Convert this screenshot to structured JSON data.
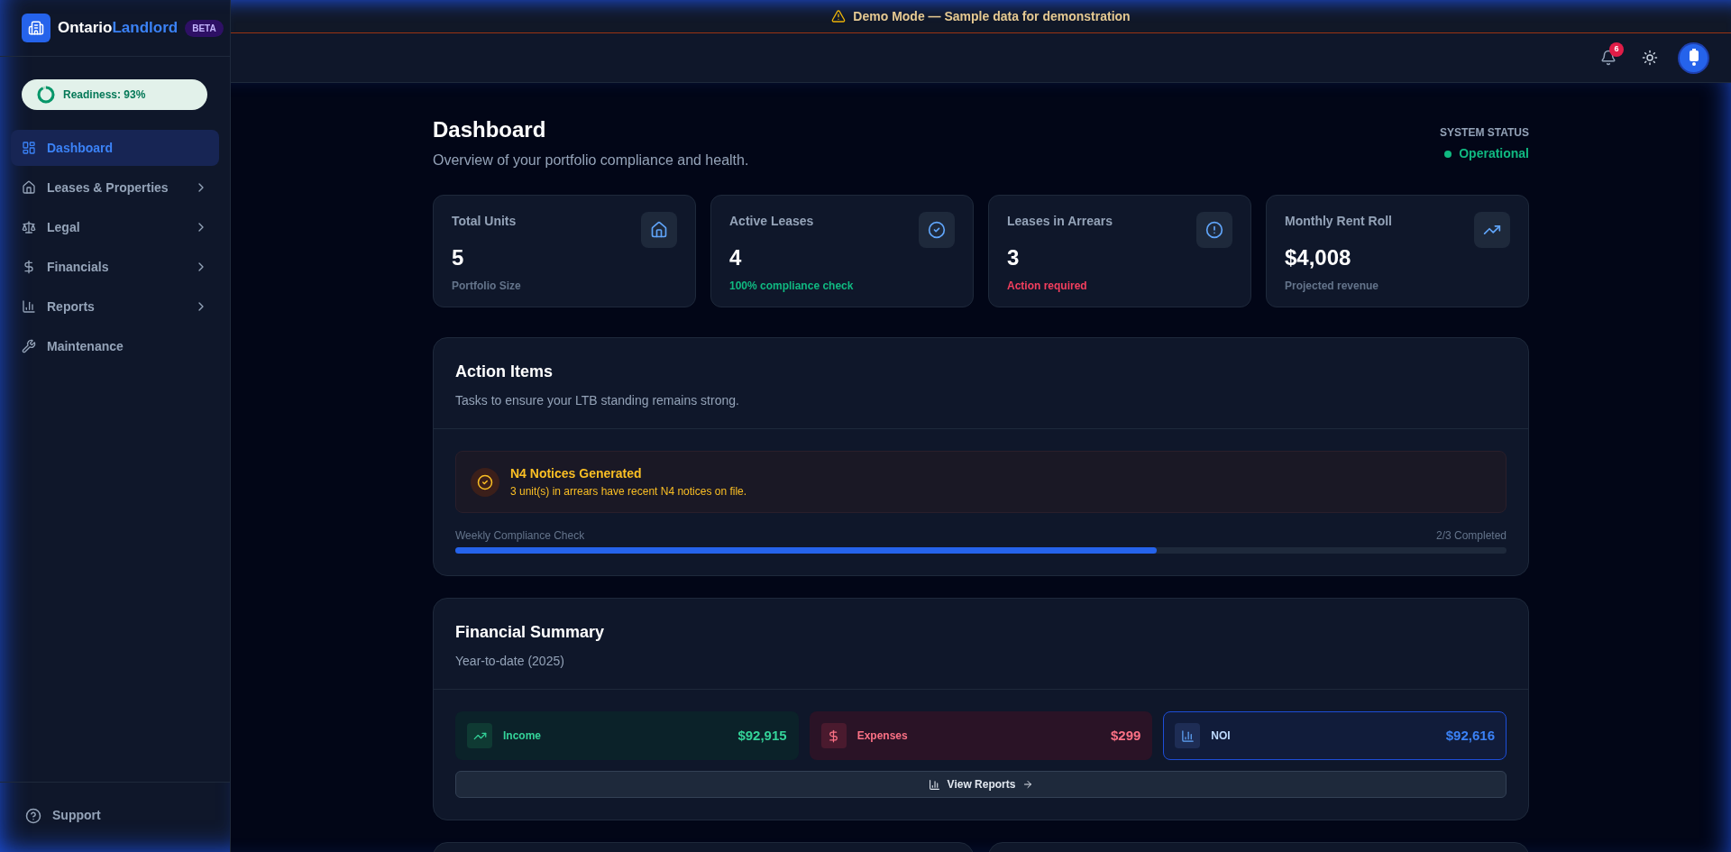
{
  "banner": {
    "text": "Demo Mode — Sample data for demonstration"
  },
  "brand": {
    "name_first": "Ontario",
    "name_second": "Landlord",
    "badge": "BETA"
  },
  "readiness": {
    "label": "Readiness: 93%",
    "level": 0.93
  },
  "nav": [
    {
      "label": "Dashboard",
      "selected": true,
      "expandable": false
    },
    {
      "label": "Leases & Properties",
      "selected": false,
      "expandable": true
    },
    {
      "label": "Legal",
      "selected": false,
      "expandable": true
    },
    {
      "label": "Financials",
      "selected": false,
      "expandable": true
    },
    {
      "label": "Reports",
      "selected": false,
      "expandable": true
    },
    {
      "label": "Maintenance",
      "selected": false,
      "expandable": false
    }
  ],
  "support": {
    "label": "Support"
  },
  "notifications": {
    "count": "6"
  },
  "header": {
    "title": "Dashboard",
    "subtitle": "Overview of your portfolio compliance and health.",
    "status_label": "SYSTEM STATUS",
    "status_value": "Operational"
  },
  "stats": [
    {
      "label": "Total Units",
      "value": "5",
      "note": "Portfolio Size",
      "kind": "neutral"
    },
    {
      "label": "Active Leases",
      "value": "4",
      "note": "100% compliance check",
      "kind": "positive"
    },
    {
      "label": "Leases in Arrears",
      "value": "3",
      "note": "Action required",
      "kind": "negative"
    },
    {
      "label": "Monthly Rent Roll",
      "value": "$4,008",
      "note": "Projected revenue",
      "kind": "neutral"
    }
  ],
  "action_items": {
    "title": "Action Items",
    "subtitle": "Tasks to ensure your LTB standing remains strong.",
    "alert": {
      "title": "N4 Notices Generated",
      "text": "3 unit(s) in arrears have recent N4 notices on file."
    },
    "progress": {
      "label": "Weekly Compliance Check",
      "reading": "2/3 Completed",
      "level": 0.667
    }
  },
  "financial": {
    "title": "Financial Summary",
    "subtitle": "Year-to-date (2025)",
    "tiles": [
      {
        "kind": "income",
        "label": "Income",
        "value": "$92,915",
        "selected": false
      },
      {
        "kind": "expenses",
        "label": "Expenses",
        "value": "$299",
        "selected": false
      },
      {
        "kind": "noi",
        "label": "NOI",
        "value": "$92,616",
        "selected": true
      }
    ],
    "button": "View Reports"
  }
}
